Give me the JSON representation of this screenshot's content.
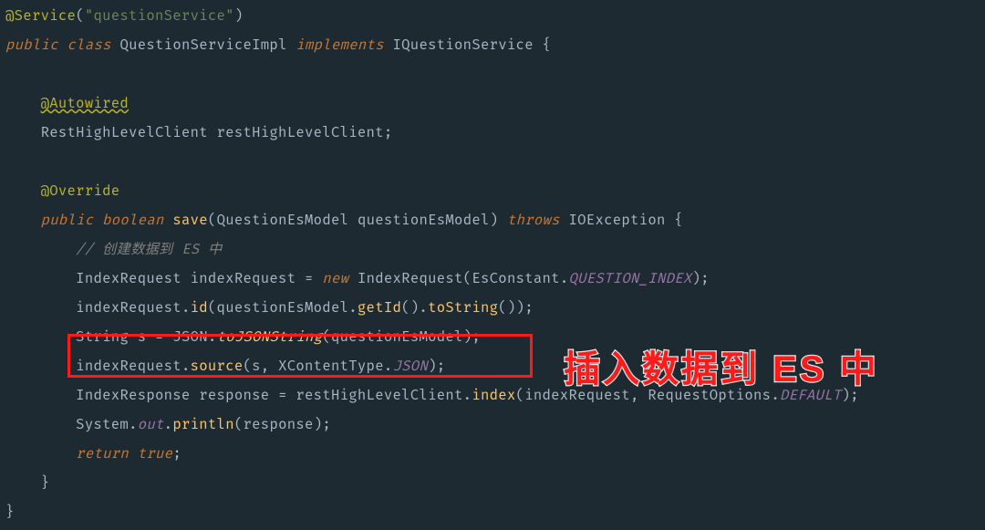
{
  "code": {
    "l1": {
      "ann": "@Service",
      "str": "\"questionService\""
    },
    "l2": {
      "kw1": "public",
      "kw2": "class",
      "cls": "QuestionServiceImpl",
      "impl": "implements",
      "iface": "IQuestionService"
    },
    "l4": {
      "ann": "@Autowired"
    },
    "l5": {
      "type": "RestHighLevelClient",
      "name": "restHighLevelClient"
    },
    "l7": {
      "ann": "@Override"
    },
    "l8": {
      "kw1": "public",
      "ret": "boolean",
      "mtd": "save",
      "ptype": "QuestionEsModel",
      "pname": "questionEsModel",
      "thr": "throws",
      "exc": "IOException"
    },
    "l9": {
      "cmt": "// 创建数据到 ES 中"
    },
    "l10": {
      "t1": "IndexRequest",
      "v1": "indexRequest",
      "eq": "=",
      "new": "new",
      "ctor": "IndexRequest",
      "cls": "EsConstant",
      "fld": "QUESTION_INDEX"
    },
    "l11": {
      "obj": "indexRequest",
      "m1": "id",
      "arg": "questionEsModel",
      "m2": "getId",
      "m3": "toString"
    },
    "l12": {
      "t1": "String",
      "v1": "s",
      "eq": "=",
      "cls": "JSON",
      "m1": "toJSONString",
      "arg": "questionEsModel"
    },
    "l13": {
      "obj": "indexRequest",
      "m1": "source",
      "a1": "s",
      "cls": "XContentType",
      "fld": "JSON"
    },
    "l14": {
      "t1": "IndexResponse",
      "v1": "response",
      "eq": "=",
      "obj": "restHighLevelClient",
      "m1": "index",
      "a1": "indexRequest",
      "cls": "RequestOptions",
      "fld": "DEFAULT"
    },
    "l15": {
      "cls": "System",
      "fld": "out",
      "m1": "println",
      "arg": "response"
    },
    "l16": {
      "kw": "return",
      "val": "true"
    }
  },
  "annotation": {
    "redbox_label": "highlighted-code",
    "banner_text": "插入数据到 ES 中"
  }
}
